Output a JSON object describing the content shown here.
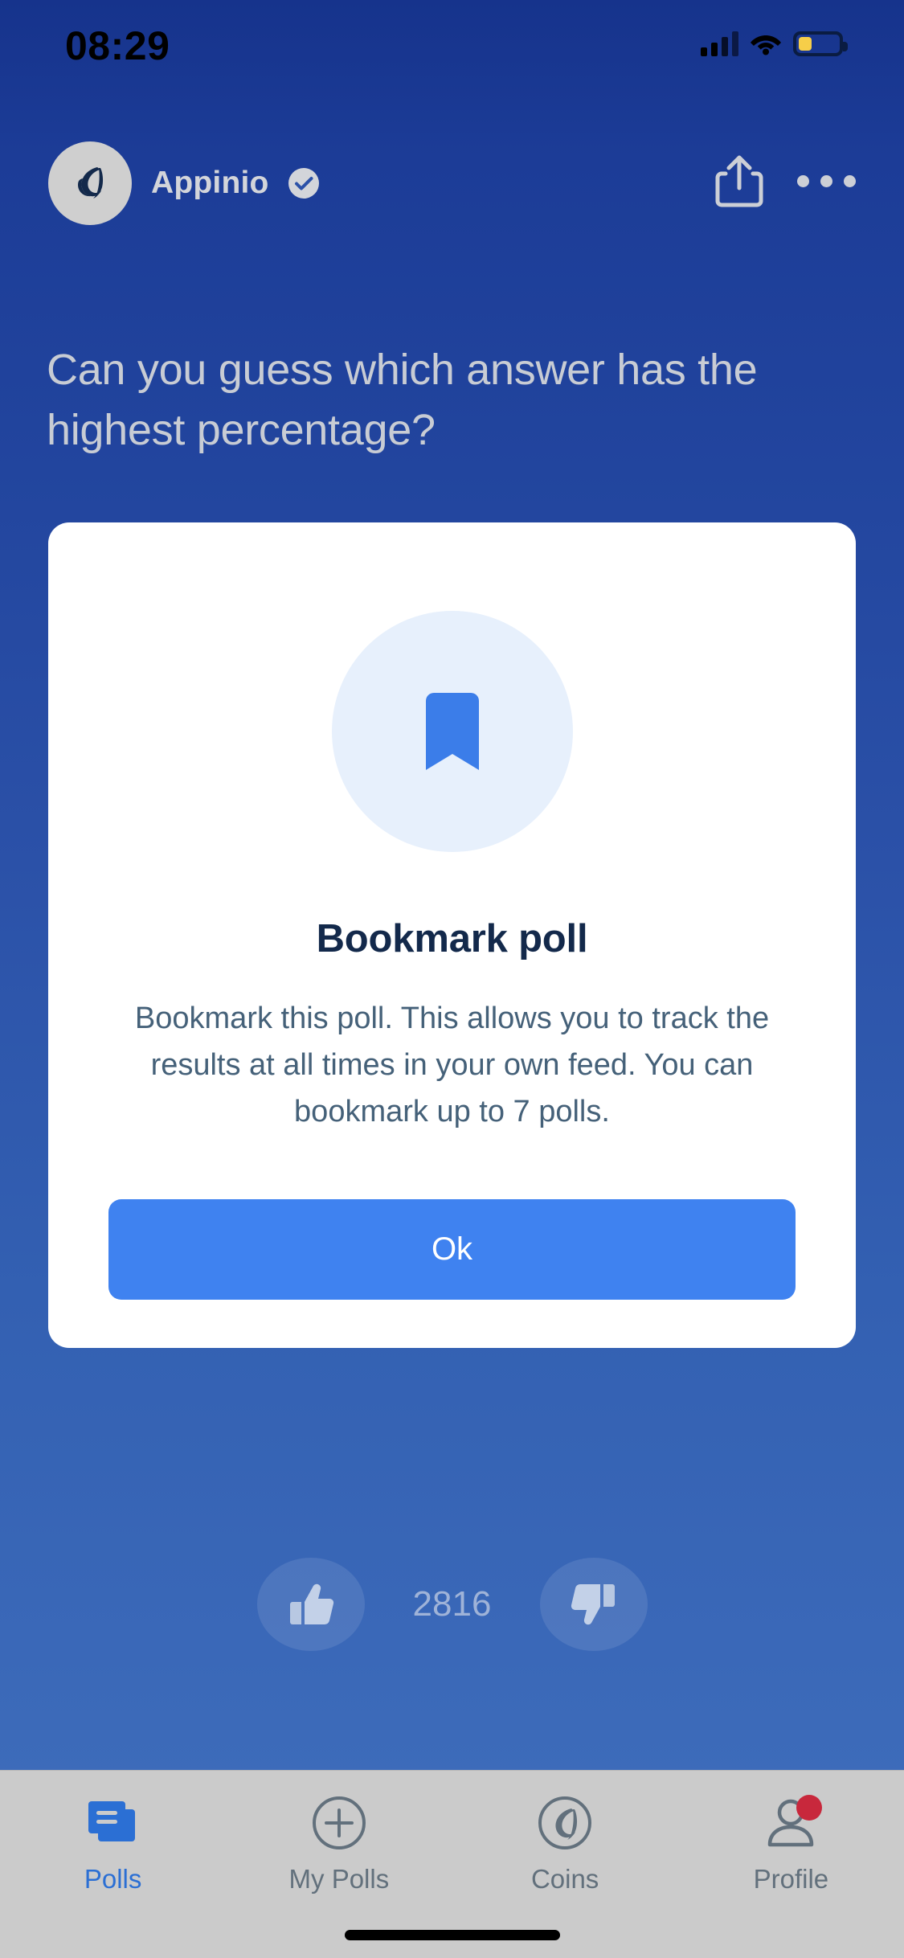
{
  "status_bar": {
    "time": "08:29",
    "signal_icon": "cellular-signal-icon",
    "wifi_icon": "wifi-icon",
    "battery_icon": "battery-low-icon",
    "battery_color": "#F6CE49"
  },
  "header": {
    "avatar_icon": "appinio-logo-avatar",
    "brand_name": "Appinio",
    "verified_icon": "verified-check-icon",
    "share_icon": "share-icon",
    "more_icon": "more-options-icon"
  },
  "poll": {
    "question": "Can you guess which answer has the highest percentage?"
  },
  "modal": {
    "icon": "bookmark-icon",
    "title": "Bookmark poll",
    "body": "Bookmark this poll. This allows you to track the results at all times in your own feed. You can bookmark up to 7 polls.",
    "confirm_label": "Ok",
    "accent_color": "#3F82F0",
    "icon_circle_color": "#E7F0FC"
  },
  "reactions": {
    "like_icon": "thumbs-up-icon",
    "dislike_icon": "thumbs-down-icon",
    "count": "2816"
  },
  "tab_bar": {
    "items": [
      {
        "label": "Polls",
        "icon": "polls-stack-icon",
        "active": true
      },
      {
        "label": "My Polls",
        "icon": "plus-circle-icon",
        "active": false
      },
      {
        "label": "Coins",
        "icon": "appinio-coin-icon",
        "active": false
      },
      {
        "label": "Profile",
        "icon": "person-icon",
        "active": false
      }
    ],
    "profile_badge": "notification-dot",
    "active_color": "#2B6FD4",
    "inactive_color": "#62707C"
  },
  "system": {
    "home_indicator": "home-indicator"
  }
}
